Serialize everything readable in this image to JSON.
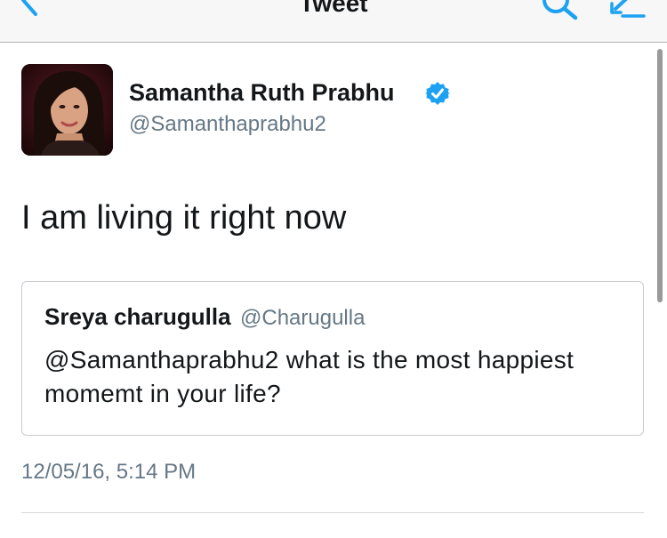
{
  "nav": {
    "title": "Tweet",
    "back_icon": "chevron-left-icon",
    "search_icon": "search-icon",
    "compose_icon": "compose-icon",
    "accent_color": "#1da1f2"
  },
  "tweet": {
    "author": {
      "display_name": "Samantha Ruth Prabhu",
      "handle": "@Samanthaprabhu2",
      "verified": true,
      "verified_icon": "verified-badge-icon",
      "avatar_icon": "avatar-photo"
    },
    "text": "I am living it right now",
    "quoted": {
      "display_name": "Sreya charugulla",
      "handle": "@Charugulla",
      "text": "@Samanthaprabhu2 what is the most happiest momemt in your life?"
    },
    "timestamp": "12/05/16, 5:14 PM"
  },
  "colors": {
    "text_primary": "#14171a",
    "text_secondary": "#657786",
    "border": "#c8ccd0",
    "verified": "#1da1f2"
  }
}
